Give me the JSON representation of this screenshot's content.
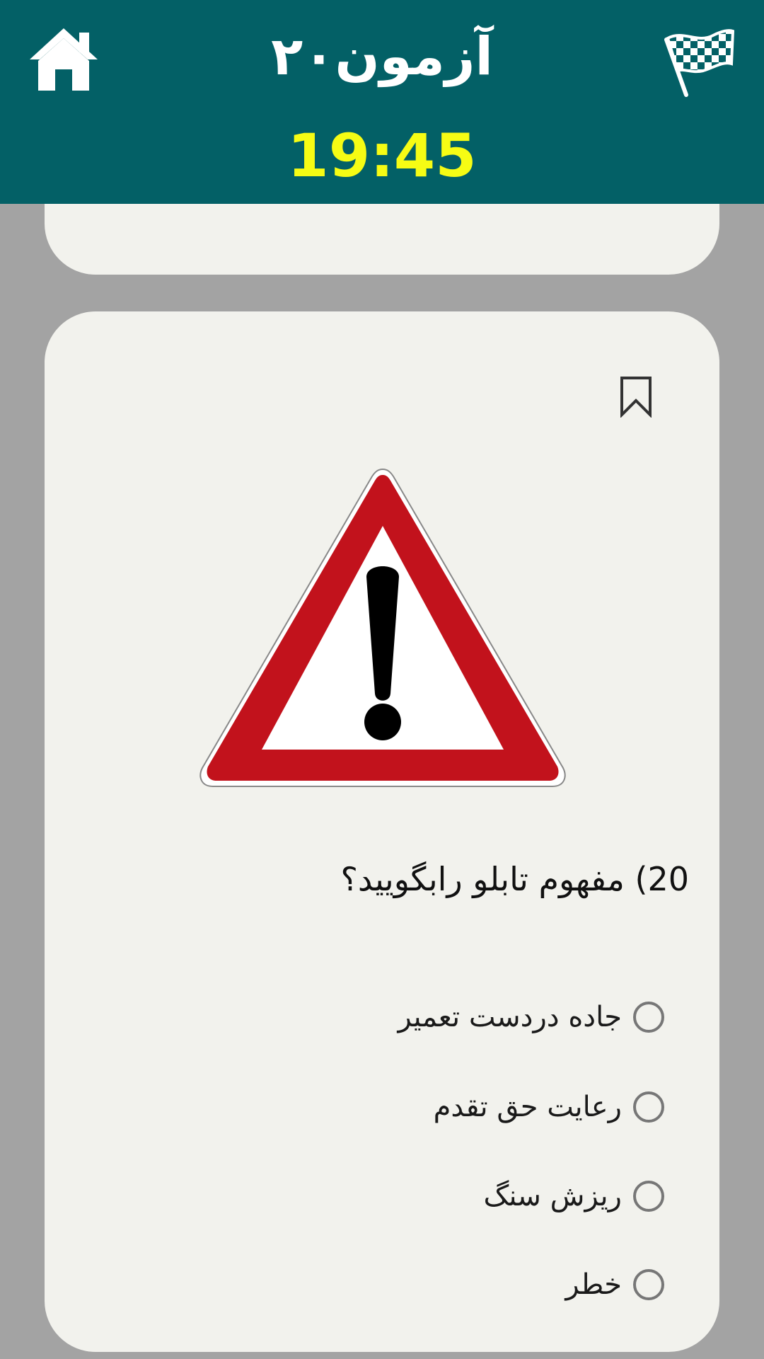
{
  "header": {
    "title": "آزمون۲۰",
    "timer": "19:45",
    "home_icon": "home-icon",
    "flag_icon": "checkered-flag-icon",
    "background_color": "#036066",
    "timer_color": "#f6fc14"
  },
  "question": {
    "number": "20)",
    "text": "مفهوم تابلو رابگویید؟",
    "bookmark_icon": "bookmark-icon",
    "sign_icon": "warning-triangle-sign-icon",
    "options": [
      {
        "label": "جاده دردست تعمیر"
      },
      {
        "label": "رعایت حق تقدم"
      },
      {
        "label": "ریزش سنگ"
      },
      {
        "label": "خطر"
      }
    ]
  },
  "colors": {
    "page_background": "#a3a3a3",
    "card_background": "#f2f2ed",
    "sign_red": "#c2121c"
  }
}
